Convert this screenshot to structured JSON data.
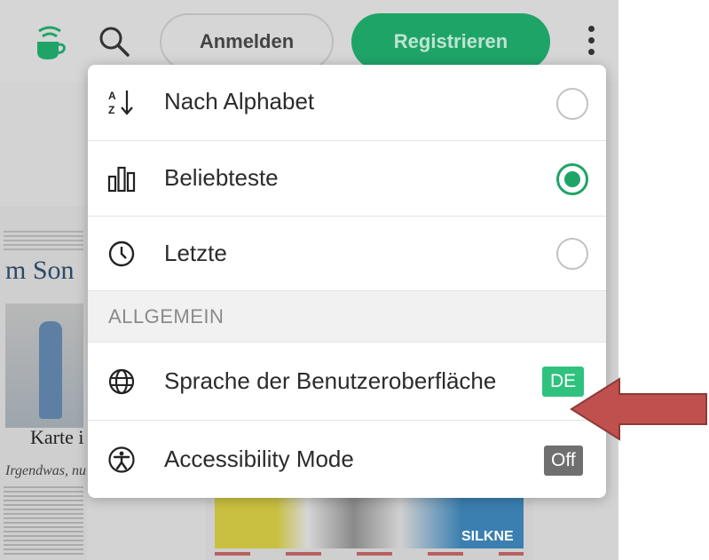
{
  "header": {
    "login_label": "Anmelden",
    "register_label": "Registrieren",
    "brand_icon": "coffee-cup-icon",
    "search_icon": "search-icon",
    "more_icon": "more-vertical-icon"
  },
  "menu": {
    "sort_options": [
      {
        "label": "Nach Alphabet",
        "icon": "sort-alpha-icon",
        "selected": false
      },
      {
        "label": "Beliebteste",
        "icon": "bar-chart-icon",
        "selected": true
      },
      {
        "label": "Letzte",
        "icon": "clock-icon",
        "selected": false
      }
    ],
    "section_title": "ALLGEMEIN",
    "settings": [
      {
        "label": "Sprache der Benutzeroberfläche",
        "icon": "globe-icon",
        "value": "DE"
      },
      {
        "label": "Accessibility Mode",
        "icon": "accessibility-icon",
        "value": "Off"
      }
    ]
  },
  "background": {
    "left_masthead": "m Son",
    "left_caption": "Karte i",
    "left_headline": "Irgendwas, nu",
    "right_image_label": "SILKNE"
  },
  "colors": {
    "accent": "#1fa468",
    "badge_on": "#2ec27e",
    "badge_off": "#6f6f6f",
    "annotation_arrow": "#c0504d"
  }
}
